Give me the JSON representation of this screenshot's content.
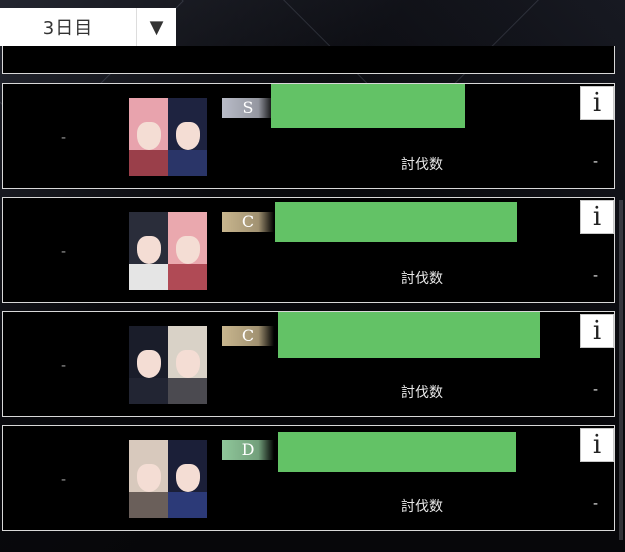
{
  "day_selector": {
    "value": "3日目",
    "arrow": "▼"
  },
  "rows": [
    {
      "dash": "-",
      "rank": "S",
      "rank_color": "#b9bcc8",
      "info": "i",
      "kill_label": "討伐数",
      "kill_value": "-",
      "portraits": [
        {
          "hair": "#e8a3ad",
          "body": "#9a3f4a"
        },
        {
          "hair": "#1e2340",
          "body": "#2a3568"
        }
      ]
    },
    {
      "dash": "-",
      "rank": "C",
      "rank_color": "#c9b68e",
      "info": "i",
      "kill_label": "討伐数",
      "kill_value": "-",
      "portraits": [
        {
          "hair": "#2a2d3a",
          "body": "#e5e5e5"
        },
        {
          "hair": "#eaa8ae",
          "body": "#b04a55"
        }
      ]
    },
    {
      "dash": "-",
      "rank": "C",
      "rank_color": "#c9b68e",
      "info": "i",
      "kill_label": "討伐数",
      "kill_value": "-",
      "portraits": [
        {
          "hair": "#1a1d2a",
          "body": "#222533"
        },
        {
          "hair": "#d9d2c7",
          "body": "#4b4a50"
        }
      ]
    },
    {
      "dash": "-",
      "rank": "D",
      "rank_color": "#8fc79a",
      "info": "i",
      "kill_label": "討伐数",
      "kill_value": "-",
      "portraits": [
        {
          "hair": "#d8c9bd",
          "body": "#6a5f5a"
        },
        {
          "hair": "#1b1f38",
          "body": "#2c3a78"
        }
      ]
    }
  ]
}
